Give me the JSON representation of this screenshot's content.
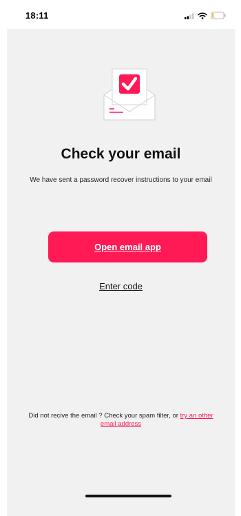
{
  "status_bar": {
    "time": "18:11",
    "icons": [
      "signal-icon",
      "wifi-icon",
      "battery-icon"
    ]
  },
  "colors": {
    "accent": "#ff1a55",
    "screen_background": "#f2f1f1",
    "text": "#111111"
  },
  "illustration": {
    "icon": "envelope-check-icon"
  },
  "content": {
    "title": "Check your email",
    "subtitle": "We have sent a password recover instructions to your email",
    "primary_button_label": "Open email app",
    "secondary_link_label": "Enter code"
  },
  "footer": {
    "note_text": "Did not recive the email ? Check your spam filter, or",
    "link_label": "try an other email address"
  }
}
